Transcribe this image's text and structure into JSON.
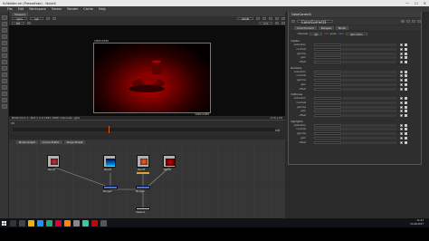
{
  "window": {
    "title": "fx3bilder.nk (Pressefoto) - NukeX",
    "controls": [
      "—",
      "☐",
      "✕"
    ]
  },
  "menubar": [
    "File",
    "Edit",
    "Workspace",
    "Viewer",
    "Render",
    "Cache",
    "Help"
  ],
  "viewer": {
    "tab": "Viewer1",
    "channels": "rgba",
    "colorspace": "rgb",
    "display": "sRGB",
    "zoom": "1:1",
    "fstop": "f/8",
    "frame_label": "1900x1080",
    "bbox_label": "1920x1080",
    "status_left": "Bildschirm 1: 2bit x 2.0 1920 1080 channels: rgba",
    "status_right": "x=0 y=0"
  },
  "timeline": {
    "fps": "24",
    "start": "1",
    "end": "100"
  },
  "node_graph": {
    "tabs": [
      "Node Graph",
      "Curve Editor",
      "Dope Sheet"
    ],
    "nodes": [
      {
        "label": "Read1"
      },
      {
        "label": "Read2"
      },
      {
        "label": "Read3"
      },
      {
        "label": "Read4"
      },
      {
        "label": "Merge1"
      },
      {
        "label": "Merge2"
      },
      {
        "label": "Viewer1"
      }
    ]
  },
  "properties": {
    "title": "ColorCorrect1",
    "tabs": [
      "ColorCorrect",
      "Ranges",
      "Node"
    ],
    "channels_label": "channels",
    "channels_value": "rgb",
    "channel_flags": [
      "red",
      "green",
      "blue",
      "rgba.alpha"
    ],
    "sections": [
      {
        "name": "master",
        "rows": [
          "saturation",
          "contrast",
          "gamma",
          "gain",
          "offset"
        ]
      },
      {
        "name": "shadows",
        "rows": [
          "saturation",
          "contrast",
          "gamma",
          "gain",
          "offset"
        ]
      },
      {
        "name": "midtones",
        "rows": [
          "saturation",
          "contrast",
          "gamma",
          "gain",
          "offset"
        ]
      },
      {
        "name": "highlights",
        "rows": [
          "saturation",
          "contrast",
          "gamma",
          "gain",
          "offset"
        ]
      }
    ]
  },
  "taskbar": {
    "time": "11:47",
    "date": "13.08.2017"
  },
  "colors": {
    "accent": "#e05a00",
    "node_read": "#b0b0b0",
    "node_merge": "#4a6fd6",
    "frame_red": "#c40000"
  }
}
